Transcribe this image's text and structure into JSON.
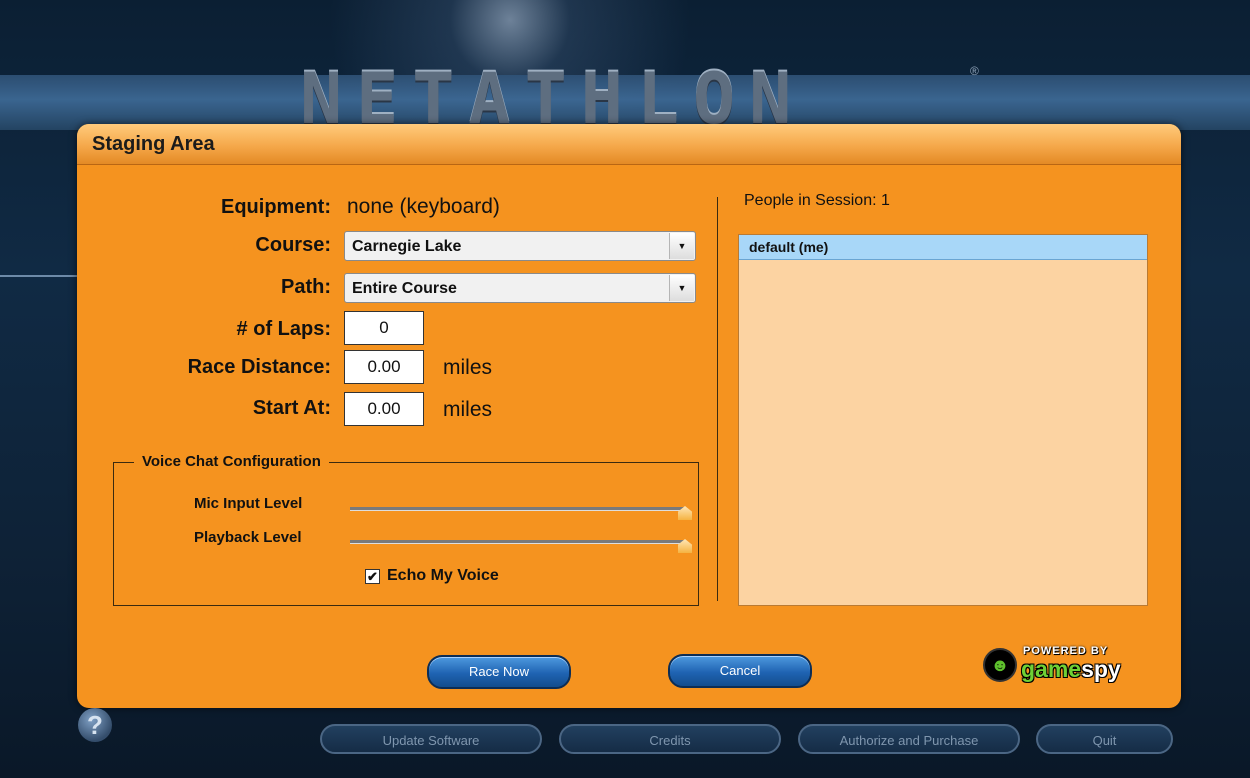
{
  "app": {
    "logo_text": "NETATHLON",
    "logo_reg": "®"
  },
  "panel": {
    "title": "Staging Area"
  },
  "form": {
    "equipment_label": "Equipment:",
    "equipment_value": "none (keyboard)",
    "course_label": "Course:",
    "course_value": "Carnegie Lake",
    "path_label": "Path:",
    "path_value": "Entire Course",
    "laps_label": "# of Laps:",
    "laps_value": "0",
    "distance_label": "Race Distance:",
    "distance_value": "0.00",
    "distance_unit": "miles",
    "start_label": "Start At:",
    "start_value": "0.00",
    "start_unit": "miles",
    "dropdown_arrow": "▼"
  },
  "voice": {
    "legend": "Voice Chat Configuration",
    "mic_label": "Mic Input Level",
    "mic_level": 1.0,
    "playback_label": "Playback Level",
    "playback_level": 1.0,
    "echo_label": "Echo My Voice",
    "echo_checked": true,
    "check_glyph": "✔"
  },
  "session": {
    "people_label": "People in Session: 1",
    "people": [
      "default (me)"
    ]
  },
  "actions": {
    "race_now": "Race Now",
    "cancel": "Cancel"
  },
  "brand": {
    "powered_by": "POWERED BY",
    "game": "game",
    "spy": "spy",
    "icon": "gamespy-logo-icon"
  },
  "bottom_nav": {
    "help": "?",
    "update": "Update Software",
    "credits": "Credits",
    "authorize": "Authorize and Purchase",
    "quit": "Quit"
  },
  "colors": {
    "panel_bg": "#f5931f",
    "button_blue": "#1f63b2",
    "list_selected": "#a8d7f8"
  }
}
